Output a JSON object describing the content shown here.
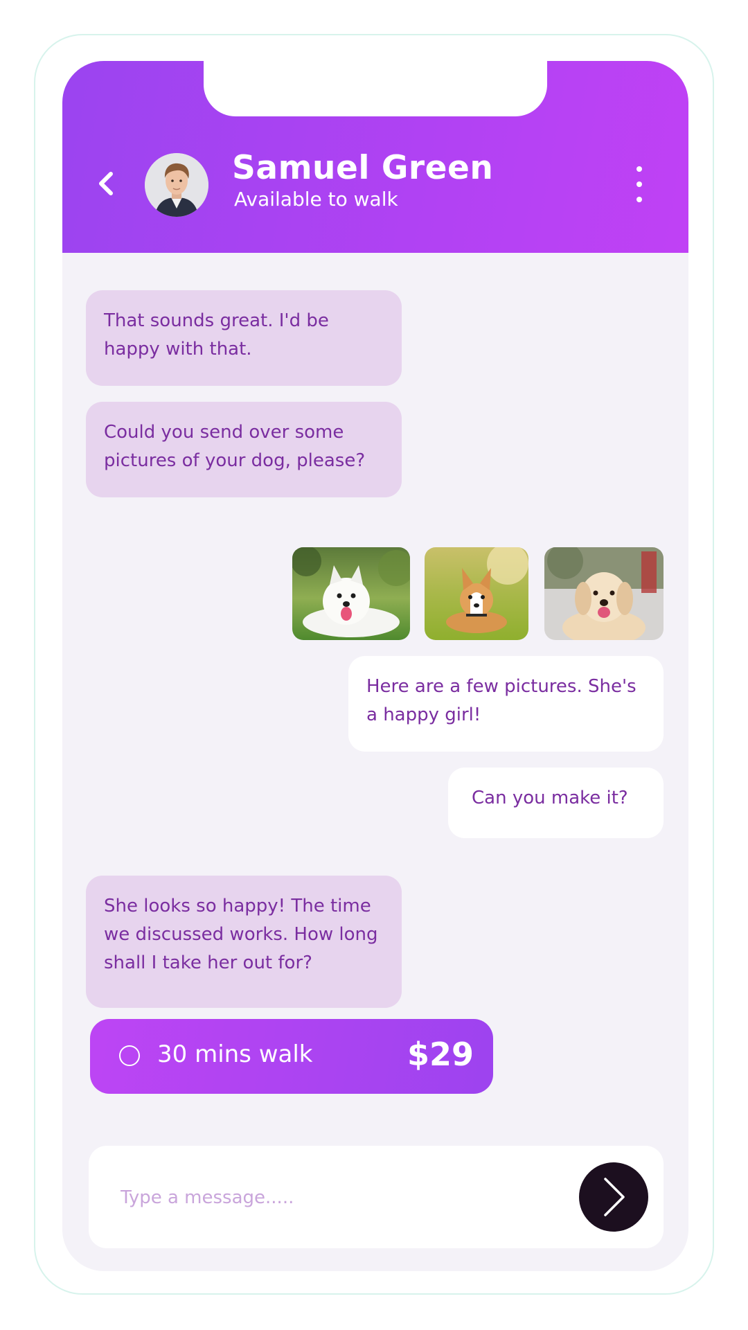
{
  "header": {
    "contact_name": "Samuel Green",
    "contact_status": "Available to walk",
    "back_icon": "chevron-left-icon",
    "more_icon": "more-vertical-icon",
    "gradient_start": "#9b44f0",
    "gradient_end": "#c041f5"
  },
  "messages": [
    {
      "direction": "incoming",
      "text": "That sounds great. I'd be happy with that."
    },
    {
      "direction": "incoming",
      "text": "Could you send over some pictures of your dog, please?"
    },
    {
      "direction": "outgoing",
      "type": "photos",
      "photos": [
        "white-spitz-dog-photo",
        "corgi-dog-photo",
        "golden-retriever-dog-photo"
      ]
    },
    {
      "direction": "outgoing",
      "text": "Here are a few pictures. She's a happy girl!"
    },
    {
      "direction": "outgoing",
      "text": "Can you make it?"
    },
    {
      "direction": "incoming",
      "text": "She looks so happy! The time we discussed works. How long shall I take her out for?"
    }
  ],
  "offer": {
    "label": "30 mins walk",
    "price": "$29",
    "selected": false
  },
  "composer": {
    "placeholder": "Type a message.....",
    "value": "",
    "send_icon": "chevron-right-icon"
  },
  "colors": {
    "accent": "#b342f3",
    "incoming_bubble": "#e7d4ee",
    "outgoing_bubble": "#ffffff",
    "message_text": "#7a2da0",
    "screen_background": "#f4f2f8",
    "send_button": "#1c0f1f"
  }
}
